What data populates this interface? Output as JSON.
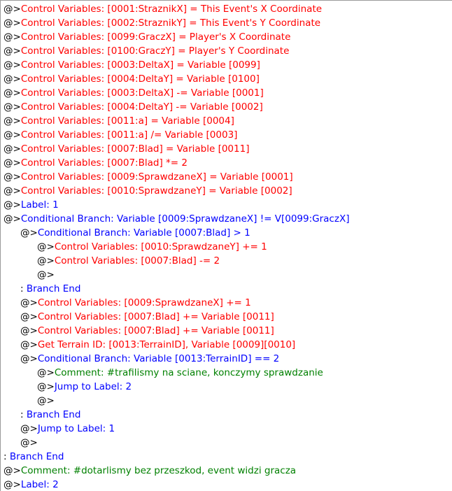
{
  "marker": "@>",
  "branch_end_marker": ": ",
  "colors": {
    "control": "#ff0000",
    "flow": "#0000ff",
    "comment": "#008000",
    "marker": "#000000"
  },
  "lines": [
    {
      "indent": 0,
      "type": "control",
      "marker": "@>",
      "text": "Control Variables: [0001:StraznikX] = This Event's X Coordinate"
    },
    {
      "indent": 0,
      "type": "control",
      "marker": "@>",
      "text": "Control Variables: [0002:StraznikY] = This Event's Y Coordinate"
    },
    {
      "indent": 0,
      "type": "control",
      "marker": "@>",
      "text": "Control Variables: [0099:GraczX] = Player's X Coordinate"
    },
    {
      "indent": 0,
      "type": "control",
      "marker": "@>",
      "text": "Control Variables: [0100:GraczY] = Player's Y Coordinate"
    },
    {
      "indent": 0,
      "type": "control",
      "marker": "@>",
      "text": "Control Variables: [0003:DeltaX] = Variable [0099]"
    },
    {
      "indent": 0,
      "type": "control",
      "marker": "@>",
      "text": "Control Variables: [0004:DeltaY] = Variable [0100]"
    },
    {
      "indent": 0,
      "type": "control",
      "marker": "@>",
      "text": "Control Variables: [0003:DeltaX] -= Variable [0001]"
    },
    {
      "indent": 0,
      "type": "control",
      "marker": "@>",
      "text": "Control Variables: [0004:DeltaY] -= Variable [0002]"
    },
    {
      "indent": 0,
      "type": "control",
      "marker": "@>",
      "text": "Control Variables: [0011:a] = Variable [0004]"
    },
    {
      "indent": 0,
      "type": "control",
      "marker": "@>",
      "text": "Control Variables: [0011:a] /= Variable [0003]"
    },
    {
      "indent": 0,
      "type": "control",
      "marker": "@>",
      "text": "Control Variables: [0007:Blad] = Variable [0011]"
    },
    {
      "indent": 0,
      "type": "control",
      "marker": "@>",
      "text": "Control Variables: [0007:Blad] *= 2"
    },
    {
      "indent": 0,
      "type": "control",
      "marker": "@>",
      "text": "Control Variables: [0009:SprawdzaneX] = Variable [0001]"
    },
    {
      "indent": 0,
      "type": "control",
      "marker": "@>",
      "text": "Control Variables: [0010:SprawdzaneY] = Variable [0002]"
    },
    {
      "indent": 0,
      "type": "flow",
      "marker": "@>",
      "text": "Label: 1"
    },
    {
      "indent": 0,
      "type": "flow",
      "marker": "@>",
      "text": "Conditional Branch: Variable [0009:SprawdzaneX] != V[0099:GraczX]"
    },
    {
      "indent": 1,
      "type": "flow",
      "marker": "@>",
      "text": "Conditional Branch: Variable [0007:Blad] > 1"
    },
    {
      "indent": 2,
      "type": "control",
      "marker": "@>",
      "text": "Control Variables: [0010:SprawdzaneY] += 1"
    },
    {
      "indent": 2,
      "type": "control",
      "marker": "@>",
      "text": "Control Variables: [0007:Blad] -= 2"
    },
    {
      "indent": 2,
      "type": "empty",
      "marker": "@>",
      "text": ""
    },
    {
      "indent": 1,
      "type": "branch_end",
      "marker": ": ",
      "text": "Branch End"
    },
    {
      "indent": 1,
      "type": "control",
      "marker": "@>",
      "text": "Control Variables: [0009:SprawdzaneX] += 1"
    },
    {
      "indent": 1,
      "type": "control",
      "marker": "@>",
      "text": "Control Variables: [0007:Blad] += Variable [0011]"
    },
    {
      "indent": 1,
      "type": "control",
      "marker": "@>",
      "text": "Control Variables: [0007:Blad] += Variable [0011]"
    },
    {
      "indent": 1,
      "type": "other",
      "marker": "@>",
      "text": "Get Terrain ID: [0013:TerrainID], Variable [0009][0010]"
    },
    {
      "indent": 1,
      "type": "flow",
      "marker": "@>",
      "text": "Conditional Branch: Variable [0013:TerrainID] == 2"
    },
    {
      "indent": 2,
      "type": "comment",
      "marker": "@>",
      "text": "Comment: #trafilismy na sciane, konczymy sprawdzanie"
    },
    {
      "indent": 2,
      "type": "flow",
      "marker": "@>",
      "text": "Jump to Label: 2"
    },
    {
      "indent": 2,
      "type": "empty",
      "marker": "@>",
      "text": ""
    },
    {
      "indent": 1,
      "type": "branch_end",
      "marker": ": ",
      "text": "Branch End"
    },
    {
      "indent": 1,
      "type": "flow",
      "marker": "@>",
      "text": "Jump to Label: 1"
    },
    {
      "indent": 1,
      "type": "empty",
      "marker": "@>",
      "text": ""
    },
    {
      "indent": 0,
      "type": "branch_end",
      "marker": ": ",
      "text": "Branch End"
    },
    {
      "indent": 0,
      "type": "comment",
      "marker": "@>",
      "text": "Comment: #dotarlismy bez przeszkod, event widzi gracza"
    },
    {
      "indent": 0,
      "type": "flow",
      "marker": "@>",
      "text": "Label: 2"
    }
  ]
}
